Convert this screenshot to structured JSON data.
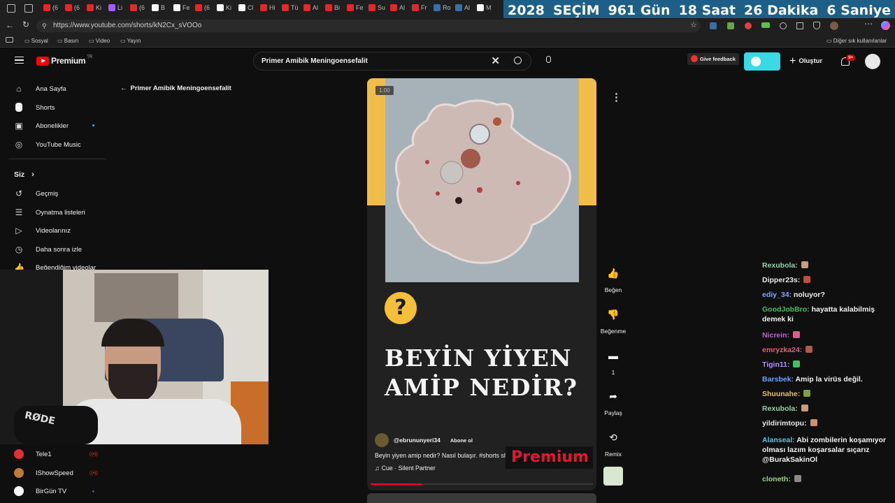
{
  "browser": {
    "countdown": [
      "2028",
      "SEÇİM",
      "961 Gün",
      "18 Saat",
      "26 Dakika",
      "6 Saniye"
    ],
    "tab_labels": [
      "(6",
      "(6",
      "Ki",
      "Li",
      "(6",
      "B",
      "Fe",
      "(6",
      "Ki",
      "Cl",
      "Hi",
      "Tü",
      "Al",
      "Bi",
      "Fe",
      "Su",
      "Al",
      "Fr",
      "Ro",
      "Al",
      "M"
    ],
    "url": "https://www.youtube.com/shorts/kN2Cx_sVOOo",
    "bookmarks": [
      "Sosyal",
      "Basın",
      "Video",
      "Yayın"
    ],
    "other_bookmarks": "Diğer sık kullanılanlar"
  },
  "youtube": {
    "logo": "Premium",
    "logo_region": "TR",
    "search_value": "Primer Amibik Meningoensefalit",
    "give_feedback": "Give feedback",
    "create": "Oluştur",
    "notif_count": "9+",
    "back_label": "Primer Amibik Meningoensefalit"
  },
  "sidebar": {
    "top": [
      {
        "label": "Ana Sayfa",
        "icon": "home-icon"
      },
      {
        "label": "Shorts",
        "icon": "shorts-icon"
      },
      {
        "label": "Abonelikler",
        "icon": "subscriptions-icon"
      },
      {
        "label": "YouTube Music",
        "icon": "music-icon"
      }
    ],
    "you_heading": "Siz",
    "you": [
      {
        "label": "Geçmiş",
        "icon": "history-icon"
      },
      {
        "label": "Oynatma listeleri",
        "icon": "playlist-icon"
      },
      {
        "label": "Videolarınız",
        "icon": "video-icon"
      },
      {
        "label": "Daha sonra izle",
        "icon": "clock-icon"
      },
      {
        "label": "Beğendiğim videolar",
        "icon": "like-icon"
      }
    ],
    "channels": [
      {
        "label": "Tele1",
        "live": "((•))"
      },
      {
        "label": "IShowSpeed",
        "live": "((•))"
      },
      {
        "label": "BirGün TV",
        "live": "•"
      }
    ]
  },
  "short": {
    "timestamp": "1.00",
    "title_line1": "BEYİN YİYEN",
    "title_line2": "AMİP NEDİR?",
    "question_mark": "?",
    "channel": "@ebrununyeri34",
    "subscribe": "Abone ol",
    "description": "Beyin yiyen amip nedir? Nasıl bulaşır. #shorts shorts",
    "music": "Cue · Silent Partner",
    "premium_watermark": "Premium",
    "actions": {
      "like": "Beğen",
      "dislike": "Beğenme",
      "comments": "1",
      "share": "Paylaş",
      "remix": "Remix"
    }
  },
  "chat": [
    {
      "user": "Rexubola:",
      "msg": "",
      "color": "#8fd3a8"
    },
    {
      "user": "Dipper23s:",
      "msg": "",
      "color": "#e8e8e8"
    },
    {
      "user": "ediy_34:",
      "msg": "noluyor?",
      "color": "#7aa8ff"
    },
    {
      "user": "GoodJobBro:",
      "msg": "hayatta kalabilmiş demek ki",
      "color": "#3fbf5f"
    },
    {
      "user": "Nicrein:",
      "msg": "",
      "color": "#c05ce0"
    },
    {
      "user": "emryzka24:",
      "msg": "",
      "color": "#e0607a"
    },
    {
      "user": "Tigin11:",
      "msg": "",
      "color": "#b08cff"
    },
    {
      "user": "Barsbek:",
      "msg": "Amip la virüs değil.",
      "color": "#6aa0ff"
    },
    {
      "user": "Shuunahe:",
      "msg": "",
      "color": "#e8c060"
    },
    {
      "user": "Rexubola:",
      "msg": "",
      "color": "#8fd3a8"
    },
    {
      "user": "yildirimtopu:",
      "msg": "",
      "color": "#e8e8e8"
    },
    {
      "user": "Alanseal:",
      "msg": "Abi zombilerin koşamıyor olması lazım koşarsalar sıçarız @BurakSakinOl",
      "color": "#4fc3e8"
    },
    {
      "user": "cloneth:",
      "msg": "",
      "color": "#a0d08a"
    }
  ]
}
